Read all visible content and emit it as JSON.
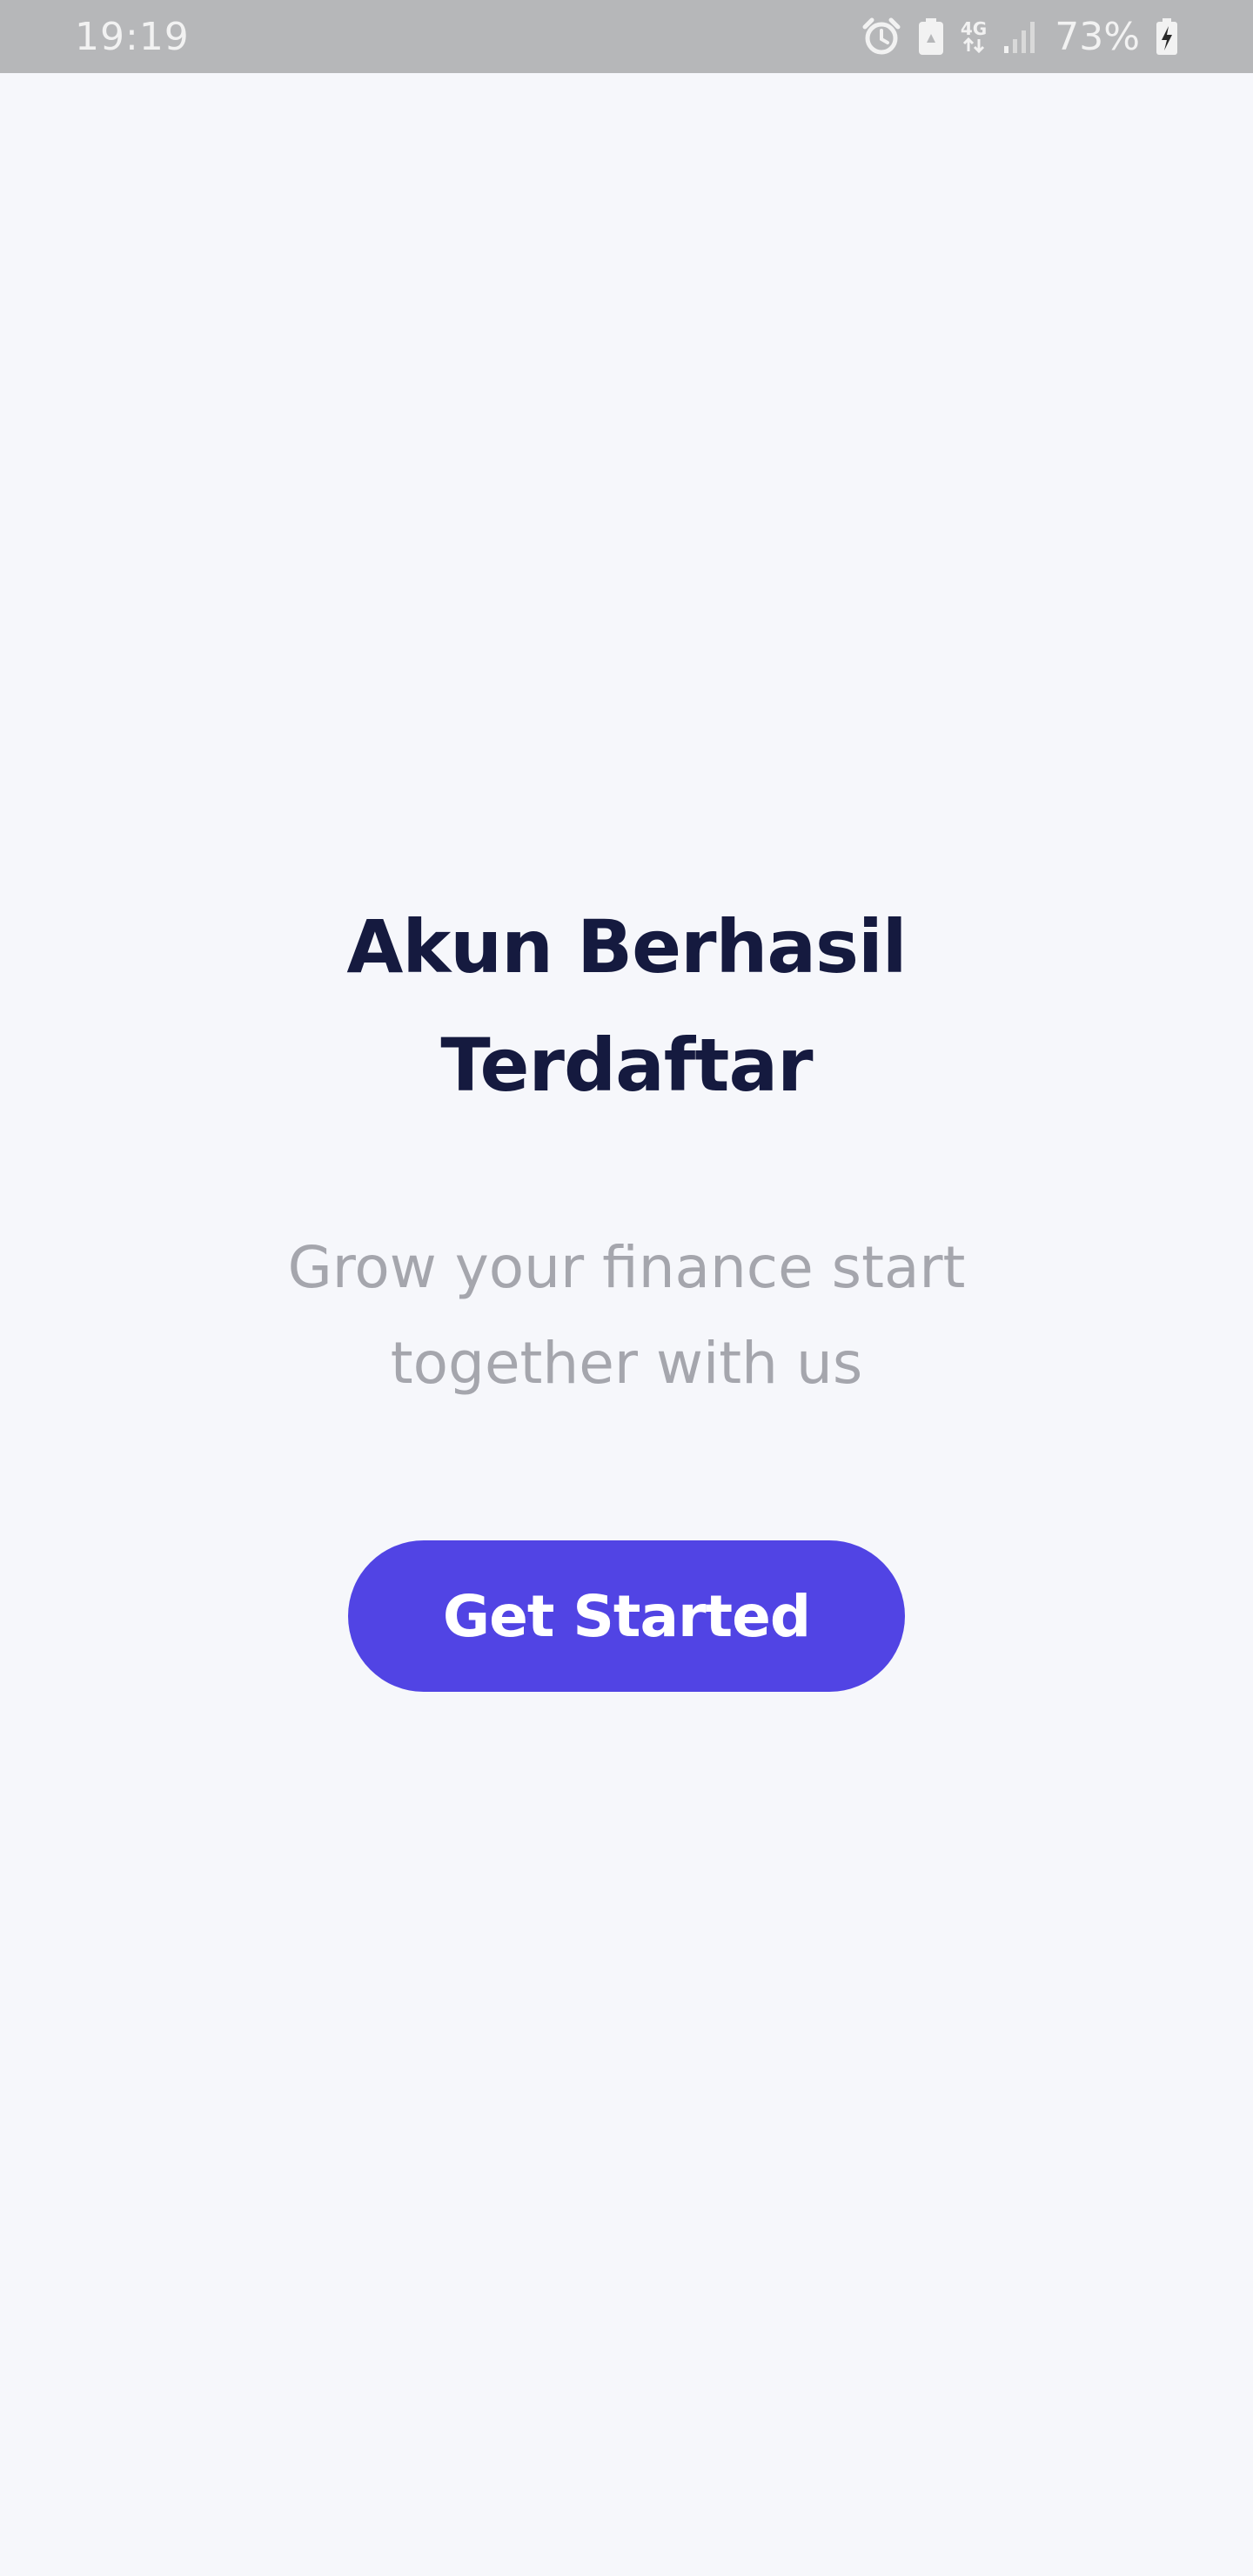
{
  "status_bar": {
    "time": "19:19",
    "network": "4G",
    "battery_percent": "73%",
    "icons": [
      "alarm-icon",
      "battery-saver-icon",
      "network-4g-icon",
      "signal-icon",
      "battery-charging-icon"
    ]
  },
  "main": {
    "title_line1": "Akun Berhasil",
    "title_line2": "Terdaftar",
    "subtitle_line1": "Grow your finance start",
    "subtitle_line2": "together with us",
    "cta_label": "Get Started"
  },
  "colors": {
    "background": "#f6f7fb",
    "status_bar": "#b6b7b9",
    "title": "#151a3f",
    "subtitle": "#a5a6ad",
    "button": "#5144e4",
    "button_text": "#ffffff"
  }
}
